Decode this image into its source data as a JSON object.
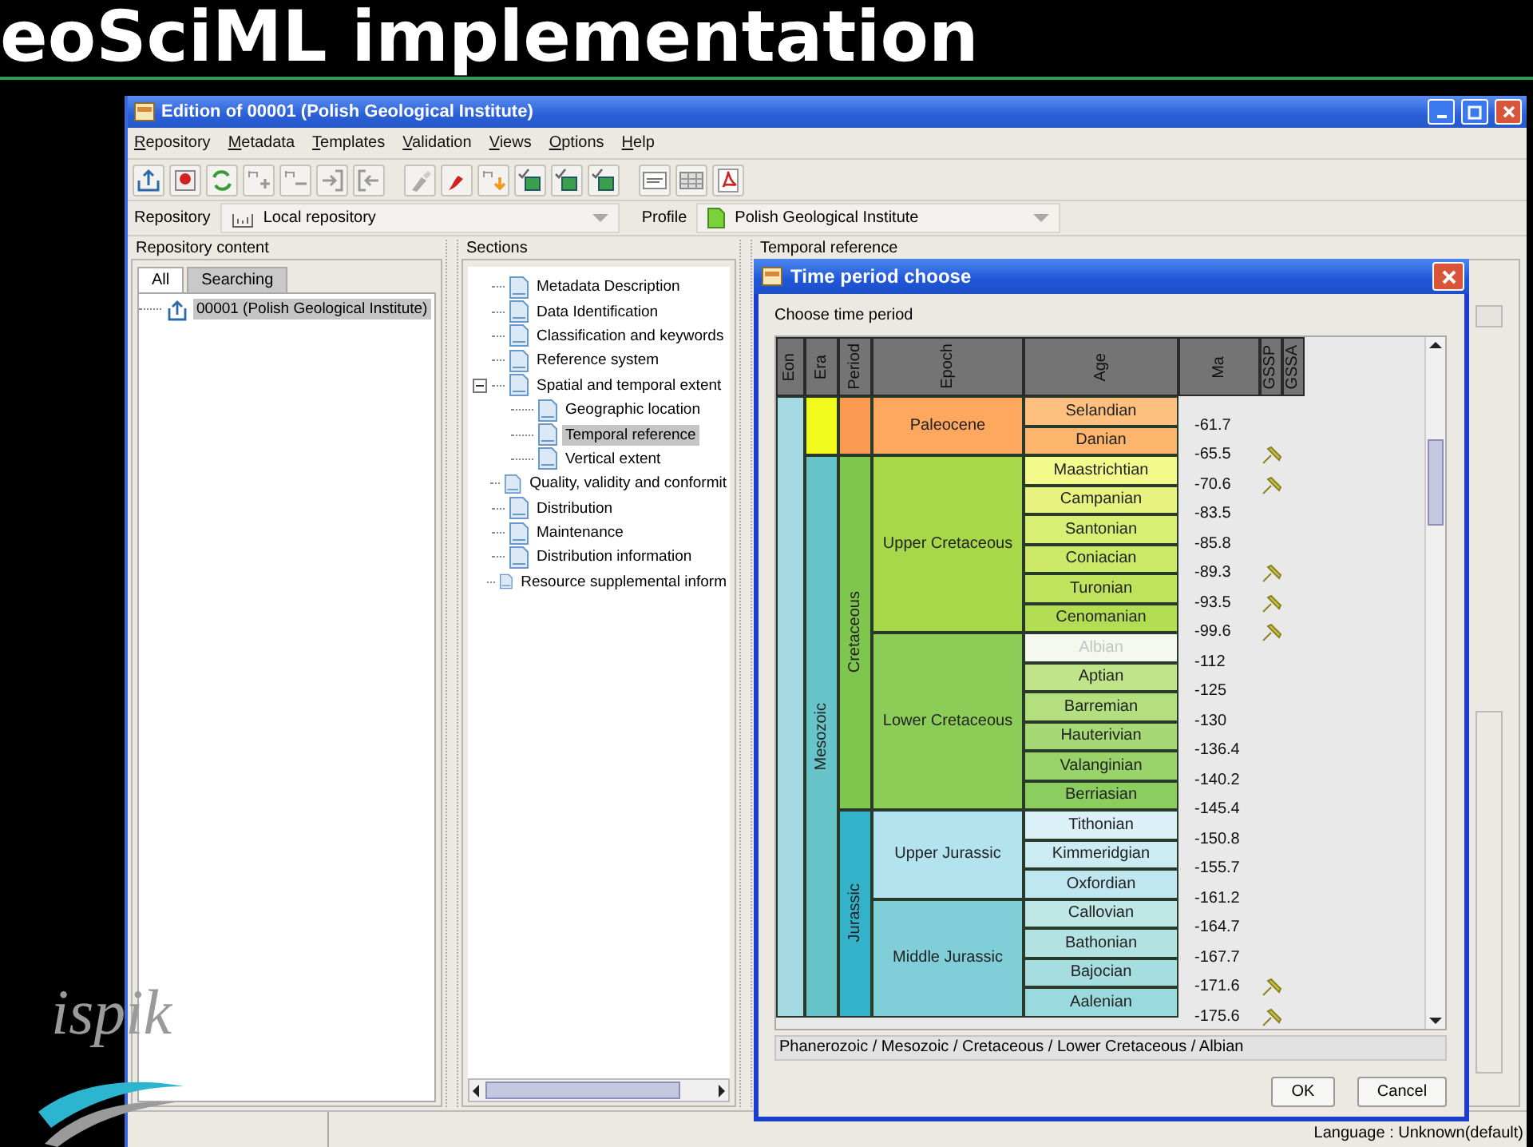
{
  "slide_title": "eoSciML implementation",
  "logo": "ispik",
  "window": {
    "title": "Edition of 00001 (Polish Geological Institute)"
  },
  "menu": [
    "Repository",
    "Metadata",
    "Templates",
    "Validation",
    "Views",
    "Options",
    "Help"
  ],
  "repository_bar": {
    "repository_label": "Repository",
    "repository": "Local repository",
    "profile_label": "Profile",
    "profile": "Polish Geological Institute"
  },
  "repository_content": {
    "title": "Repository content",
    "tabs": [
      {
        "label": "All",
        "selected": true
      },
      {
        "label": "Searching",
        "selected": false
      }
    ],
    "items": [
      {
        "label": "00001 (Polish Geological Institute)",
        "selected": true
      }
    ]
  },
  "sections": {
    "title": "Sections",
    "items": [
      {
        "label": "Metadata Description",
        "selected": false
      },
      {
        "label": "Data Identification",
        "selected": false
      },
      {
        "label": "Classification and keywords",
        "selected": false
      },
      {
        "label": "Reference system",
        "selected": false
      },
      {
        "label": "Spatial and temporal extent",
        "selected": false,
        "expanded": true,
        "children": [
          {
            "label": "Geographic location",
            "selected": false
          },
          {
            "label": "Temporal reference",
            "selected": true
          },
          {
            "label": "Vertical extent",
            "selected": false
          }
        ]
      },
      {
        "label": "Quality, validity and conformit",
        "selected": false
      },
      {
        "label": "Distribution",
        "selected": false
      },
      {
        "label": "Maintenance",
        "selected": false
      },
      {
        "label": "Distribution information",
        "selected": false
      },
      {
        "label": "Resource supplemental inform",
        "selected": false
      }
    ]
  },
  "temporal_reference": {
    "title": "Temporal reference"
  },
  "dialog": {
    "title": "Time period choose",
    "prompt": "Choose time period",
    "columns": [
      "Eon",
      "Era",
      "Period",
      "Epoch",
      "Age",
      "Ma",
      "GSSP",
      "GSSA"
    ],
    "timescale": {
      "color": "#a6dae2",
      "children": [
        {
          "color": "#f2f91d",
          "children": [
            {
              "color": "#fd9a52",
              "children": [
                {
                  "label": "Paleocene",
                  "color": "#fda75f",
                  "children": [
                    {
                      "label": "Selandian",
                      "color": "#fec07f",
                      "ma": "-61.7",
                      "gssp": false,
                      "selected": false
                    },
                    {
                      "label": "Danian",
                      "color": "#fdb46c",
                      "ma": "-65.5",
                      "gssp": true,
                      "selected": false
                    }
                  ]
                }
              ]
            }
          ]
        },
        {
          "label": "Mesozoic",
          "color": "#67c5ca",
          "children": [
            {
              "label": "Cretaceous",
              "color": "#7fc64e",
              "children": [
                {
                  "label": "Upper Cretaceous",
                  "color": "#a6d84a",
                  "children": [
                    {
                      "label": "Maastrichtian",
                      "color": "#f2fa8c",
                      "ma": "-70.6",
                      "gssp": true,
                      "selected": false
                    },
                    {
                      "label": "Campanian",
                      "color": "#e6f47f",
                      "ma": "-83.5",
                      "gssp": false,
                      "selected": false
                    },
                    {
                      "label": "Santonian",
                      "color": "#d9ef74",
                      "ma": "-85.8",
                      "gssp": false,
                      "selected": false
                    },
                    {
                      "label": "Coniacian",
                      "color": "#cce968",
                      "ma": "-89.3",
                      "gssp": true,
                      "selected": false
                    },
                    {
                      "label": "Turonian",
                      "color": "#bfe35d",
                      "ma": "-93.5",
                      "gssp": true,
                      "selected": false
                    },
                    {
                      "label": "Cenomanian",
                      "color": "#b3de53",
                      "ma": "-99.6",
                      "gssp": true,
                      "selected": false
                    }
                  ]
                },
                {
                  "label": "Lower Cretaceous",
                  "color": "#8ccd57",
                  "children": [
                    {
                      "label": "Albian",
                      "color": "#f4f8ee",
                      "ma": "-112",
                      "gssp": false,
                      "selected": true
                    },
                    {
                      "label": "Aptian",
                      "color": "#bfe48a",
                      "ma": "-125",
                      "gssp": false,
                      "selected": false
                    },
                    {
                      "label": "Barremian",
                      "color": "#b3df7f",
                      "ma": "-130",
                      "gssp": false,
                      "selected": false
                    },
                    {
                      "label": "Hauterivian",
                      "color": "#a6d975",
                      "ma": "-136.4",
                      "gssp": false,
                      "selected": false
                    },
                    {
                      "label": "Valanginian",
                      "color": "#99d36a",
                      "ma": "-140.2",
                      "gssp": false,
                      "selected": false
                    },
                    {
                      "label": "Berriasian",
                      "color": "#8ccd60",
                      "ma": "-145.4",
                      "gssp": false,
                      "selected": false
                    }
                  ]
                }
              ]
            },
            {
              "label": "Jurassic",
              "color": "#34b2c9",
              "children": [
                {
                  "label": "Upper Jurassic",
                  "color": "#b3e3ee",
                  "children": [
                    {
                      "label": "Tithonian",
                      "color": "#d9f1f7",
                      "ma": "-150.8",
                      "gssp": false,
                      "selected": false
                    },
                    {
                      "label": "Kimmeridgian",
                      "color": "#ccecf4",
                      "ma": "-155.7",
                      "gssp": false,
                      "selected": false
                    },
                    {
                      "label": "Oxfordian",
                      "color": "#bfe7f1",
                      "ma": "-161.2",
                      "gssp": false,
                      "selected": false
                    }
                  ]
                },
                {
                  "label": "Middle Jurassic",
                  "color": "#80cfd8",
                  "children": [
                    {
                      "label": "Callovian",
                      "color": "#bfe7e5",
                      "ma": "-164.7",
                      "gssp": false,
                      "selected": false
                    },
                    {
                      "label": "Bathonian",
                      "color": "#b3e2e3",
                      "ma": "-167.7",
                      "gssp": false,
                      "selected": false
                    },
                    {
                      "label": "Bajocian",
                      "color": "#a6dde0",
                      "ma": "-171.6",
                      "gssp": true,
                      "selected": false
                    },
                    {
                      "label": "Aalenian",
                      "color": "#9ad9dd",
                      "ma": "-175.6",
                      "gssp": true,
                      "selected": false
                    }
                  ]
                }
              ]
            }
          ]
        }
      ]
    },
    "path": "Phanerozoic / Mesozoic / Cretaceous / Lower Cretaceous / Albian",
    "buttons": [
      "OK",
      "Cancel"
    ]
  },
  "status_bar": {
    "language": "Language : Unknown(default)"
  }
}
